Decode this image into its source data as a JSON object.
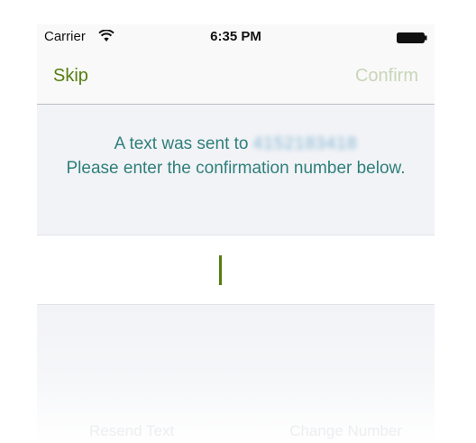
{
  "status_bar": {
    "carrier": "Carrier",
    "time": "6:35 PM",
    "wifi_icon": "wifi-icon",
    "battery_icon": "battery-full-icon"
  },
  "nav": {
    "left_label": "Skip",
    "right_label": "Confirm",
    "left_color": "#557e10",
    "right_color_disabled": "#c7d6b7"
  },
  "message": {
    "line_prefix": "A text was sent to",
    "phone_number": "4152183418",
    "line_rest": "Please enter the confirmation number below."
  },
  "input": {
    "value": "",
    "placeholder": ""
  },
  "bottom": {
    "resend_label": "Resend Text",
    "change_label": "Change Number"
  },
  "colors": {
    "accent": "#557e10",
    "message_text": "#2f7f7b",
    "background": "#f2f3f7"
  }
}
